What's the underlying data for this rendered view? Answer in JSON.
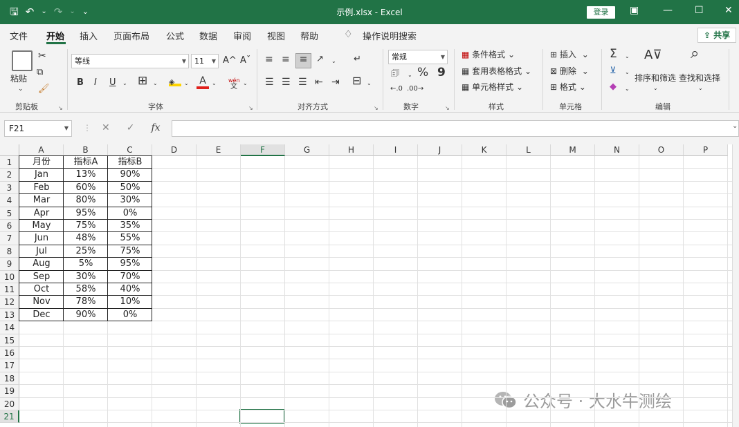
{
  "window": {
    "title": "示例.xlsx  -  Excel",
    "login_label": "登录",
    "minimize_glyph": "—",
    "restore_glyph": "☐",
    "close_glyph": "✕",
    "display_glyph": "▣"
  },
  "qat": {
    "save_glyph": "🖫",
    "undo_glyph": "↶",
    "redo_glyph": "↷",
    "customize_glyph": "⌄"
  },
  "tabs": [
    {
      "label": "文件"
    },
    {
      "label": "开始"
    },
    {
      "label": "插入"
    },
    {
      "label": "页面布局"
    },
    {
      "label": "公式"
    },
    {
      "label": "数据"
    },
    {
      "label": "审阅"
    },
    {
      "label": "视图"
    },
    {
      "label": "帮助"
    }
  ],
  "search": {
    "label": "操作说明搜索"
  },
  "share": {
    "label": "共享"
  },
  "ribbon": {
    "clipboard": {
      "paste": "粘贴",
      "group": "剪贴板"
    },
    "font": {
      "name": "等线",
      "size": "11",
      "group": "字体",
      "bold": "B",
      "italic": "I",
      "underline": "U",
      "grow": "A^",
      "shrink": "Aˇ",
      "phonetic": "wén"
    },
    "alignment": {
      "group": "对齐方式"
    },
    "number": {
      "format": "常规",
      "percent": "%",
      "comma": "9",
      "group": "数字"
    },
    "styles": {
      "conditional": "条件格式",
      "table": "套用表格格式",
      "cell": "单元格样式",
      "group": "样式"
    },
    "cells": {
      "insert": "插入",
      "delete": "删除",
      "format": "格式",
      "group": "单元格"
    },
    "editing": {
      "sort": "排序和筛选",
      "find": "查找和选择",
      "sum": "Σ",
      "group": "编辑"
    }
  },
  "formula_bar": {
    "name_box": "F21",
    "cancel": "✕",
    "enter": "✓",
    "fx": "fx",
    "formula": ""
  },
  "columns": [
    "A",
    "B",
    "C",
    "D",
    "E",
    "F",
    "G",
    "H",
    "I",
    "J",
    "K",
    "L",
    "M",
    "N",
    "O",
    "P"
  ],
  "selected_column": "F",
  "rows": [
    "1",
    "2",
    "3",
    "4",
    "5",
    "6",
    "7",
    "8",
    "9",
    "10",
    "11",
    "12",
    "13",
    "14",
    "15",
    "16",
    "17",
    "18",
    "19",
    "20",
    "21"
  ],
  "selected_row": "21",
  "table": {
    "headers": [
      "月份",
      "指标A",
      "指标B"
    ],
    "data": [
      [
        "Jan",
        "13%",
        "90%"
      ],
      [
        "Feb",
        "60%",
        "50%"
      ],
      [
        "Mar",
        "80%",
        "30%"
      ],
      [
        "Apr",
        "95%",
        "0%"
      ],
      [
        "May",
        "75%",
        "35%"
      ],
      [
        "Jun",
        "48%",
        "55%"
      ],
      [
        "Jul",
        "25%",
        "75%"
      ],
      [
        "Aug",
        "5%",
        "95%"
      ],
      [
        "Sep",
        "30%",
        "70%"
      ],
      [
        "Oct",
        "58%",
        "40%"
      ],
      [
        "Nov",
        "78%",
        "10%"
      ],
      [
        "Dec",
        "90%",
        "0%"
      ]
    ]
  },
  "watermark": {
    "text": "公众号 · 大水牛测绘"
  },
  "colors": {
    "accent": "#217346",
    "ribbon_bg": "#f3f3f3",
    "grid_line": "#e1e1e1"
  }
}
